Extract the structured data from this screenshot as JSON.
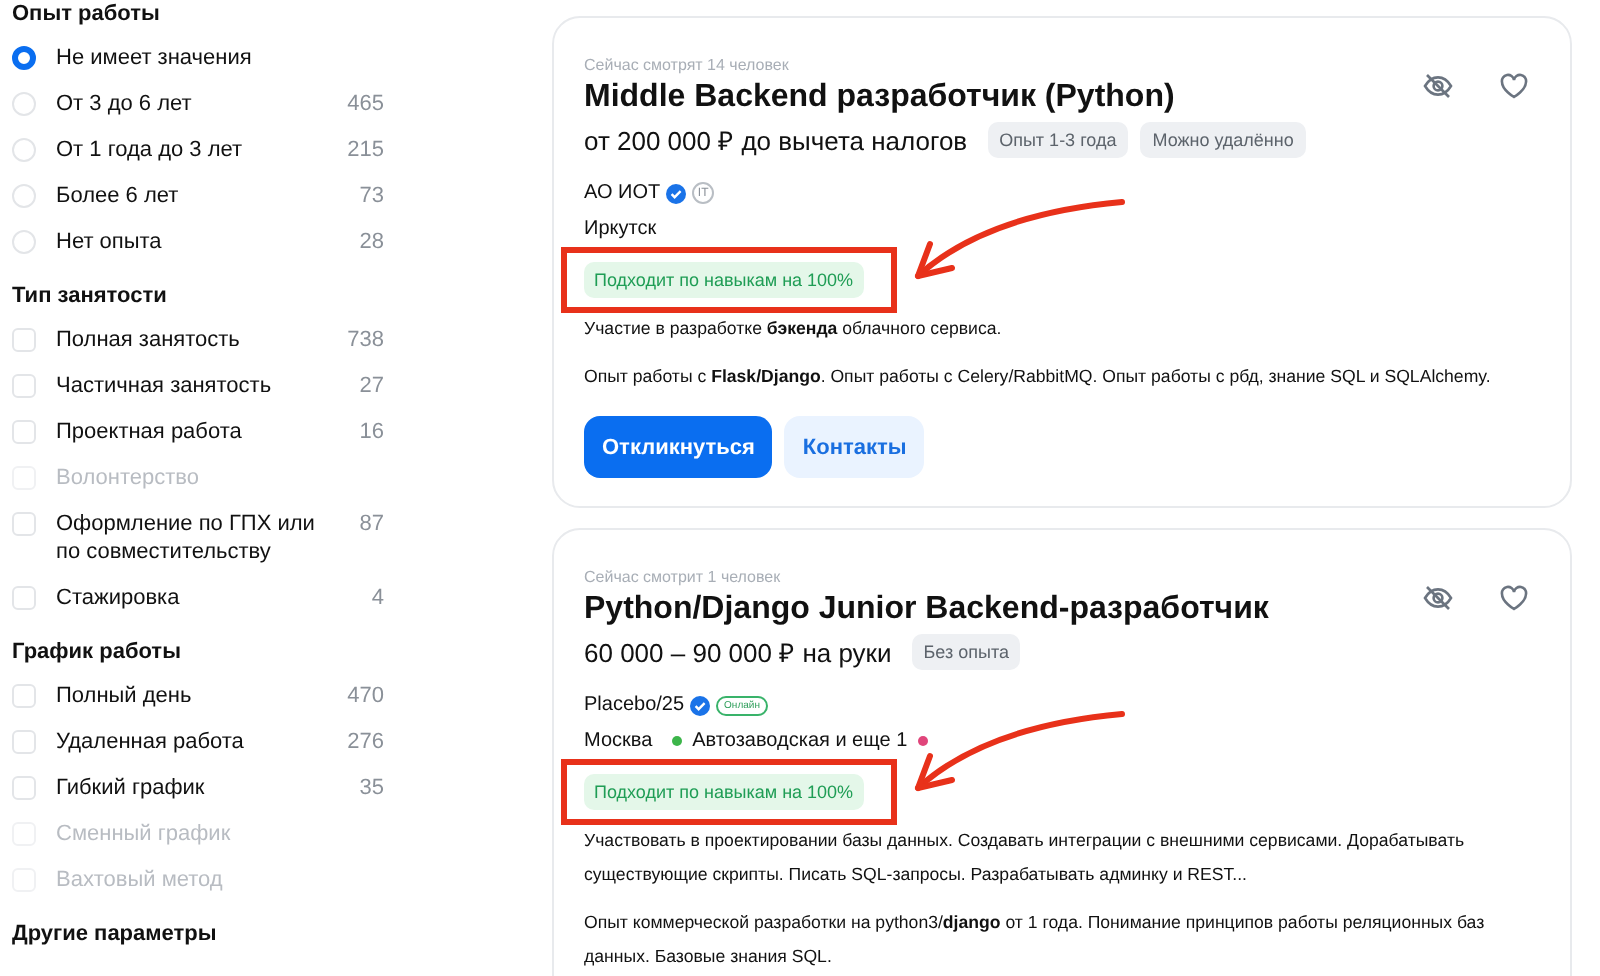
{
  "filters": [
    {
      "title": "Опыт работы",
      "kind": "radio",
      "options": [
        {
          "label": "Не имеет значения",
          "selected": true,
          "disabled": false
        },
        {
          "label": "От 3 до 6 лет",
          "count": "465",
          "selected": false,
          "disabled": false
        },
        {
          "label": "От 1 года до 3 лет",
          "count": "215",
          "selected": false,
          "disabled": false
        },
        {
          "label": "Более 6 лет",
          "count": "73",
          "selected": false,
          "disabled": false
        },
        {
          "label": "Нет опыта",
          "count": "28",
          "selected": false,
          "disabled": false
        }
      ]
    },
    {
      "title": "Тип занятости",
      "kind": "checkbox",
      "options": [
        {
          "label": "Полная занятость",
          "count": "738",
          "checked": false,
          "disabled": false
        },
        {
          "label": "Частичная занятость",
          "count": "27",
          "checked": false,
          "disabled": false
        },
        {
          "label": "Проектная работа",
          "count": "16",
          "checked": false,
          "disabled": false
        },
        {
          "label": "Волонтерство",
          "checked": false,
          "disabled": true
        },
        {
          "label": "Оформление по ГПХ или по совместительству",
          "count": "87",
          "checked": false,
          "disabled": false
        },
        {
          "label": "Стажировка",
          "count": "4",
          "checked": false,
          "disabled": false
        }
      ]
    },
    {
      "title": "График работы",
      "kind": "checkbox",
      "options": [
        {
          "label": "Полный день",
          "count": "470",
          "checked": false,
          "disabled": false
        },
        {
          "label": "Удаленная работа",
          "count": "276",
          "checked": false,
          "disabled": false
        },
        {
          "label": "Гибкий график",
          "count": "35",
          "checked": false,
          "disabled": false
        },
        {
          "label": "Сменный график",
          "checked": false,
          "disabled": true
        },
        {
          "label": "Вахтовый метод",
          "checked": false,
          "disabled": true
        }
      ]
    },
    {
      "title": "Другие параметры"
    }
  ],
  "vacancies": [
    {
      "viewers": "Сейчас смотрят 14 человек",
      "title": "Middle Backend разработчик (Python)",
      "salary": "от 200 000 ₽ до вычета налогов",
      "tags": [
        "Опыт 1-3 года",
        "Можно удалённо"
      ],
      "company": "АО ИОТ",
      "verified": true,
      "company_badge": {
        "kind": "it",
        "text": "IT"
      },
      "city": "Иркутск",
      "match": "Подходит по навыкам на 100%",
      "annotated": true,
      "description": [
        "Участие в разработке **бэкенда** облачного сервиса.",
        "Опыт работы с **Flask/Django**. Опыт работы с Celery/RabbitMQ. Опыт работы с рбд, знание SQL и SQLAlchemy."
      ],
      "buttons": [
        {
          "kind": "primary",
          "label": "Откликнуться"
        },
        {
          "kind": "secondary",
          "label": "Контакты"
        }
      ]
    },
    {
      "viewers": "Сейчас смотрит 1 человек",
      "title": "Python/Django Junior Backend-разработчик",
      "salary": "60 000 – 90 000 ₽ на руки",
      "tags": [
        "Без опыта"
      ],
      "company": "Placebo/25",
      "verified": true,
      "company_badge": {
        "kind": "online",
        "text": "Онлайн"
      },
      "city": "Москва",
      "metro": {
        "label": "Автозаводская и еще 1",
        "dots": [
          {
            "color": "#3cb54a"
          },
          {
            "color": "#e0457b"
          }
        ]
      },
      "match": "Подходит по навыкам на 100%",
      "annotated": true,
      "description": [
        "Участвовать в проектировании базы данных. Создавать интеграции с внешними сервисами. Дорабатывать существующие скрипты. Писать SQL-запросы. Разрабатывать админку и REST...",
        "Опыт коммерческой разработки на python3/**django** от 1 года. Понимание принципов работы реляционных баз данных. Базовые знания SQL."
      ]
    }
  ]
}
